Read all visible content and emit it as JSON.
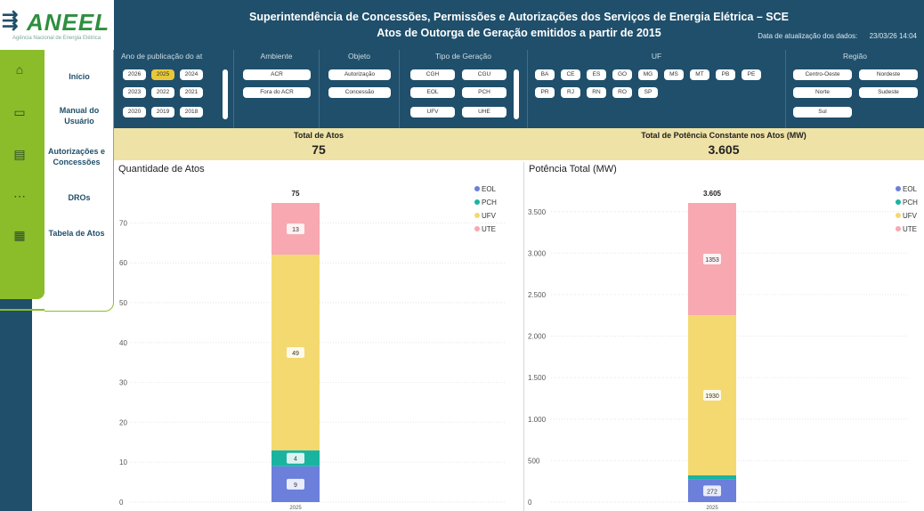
{
  "logo": {
    "text": "ANEEL",
    "subtitle": "Agência Nacional de Energia Elétrica"
  },
  "nav": {
    "items": [
      {
        "label": "Início"
      },
      {
        "label": "Manual do Usuário"
      },
      {
        "label": "Autorizações e Concessões"
      },
      {
        "label": "DROs"
      },
      {
        "label": "Tabela de Atos"
      }
    ]
  },
  "header": {
    "title": "Superintendência de Concessões, Permissões e Autorizações dos Serviços de Energia Elétrica – SCE",
    "subtitle": "Atos de Outorga de Geração emitidos a partir de 2015",
    "date_label": "Data de atualização dos dados:",
    "date_value": "23/03/26 14:04"
  },
  "filters": {
    "ano": {
      "label": "Ano de publicação do at",
      "options": [
        "2026",
        "2025",
        "2024",
        "2023",
        "2022",
        "2021",
        "2020",
        "2019",
        "2018"
      ],
      "selected": "2025"
    },
    "ambiente": {
      "label": "Ambiente",
      "options": [
        "ACR",
        "Fora do ACR"
      ]
    },
    "objeto": {
      "label": "Objeto",
      "options": [
        "Autorização",
        "Concessão"
      ]
    },
    "tipo": {
      "label": "Tipo de Geração",
      "options": [
        "CGH",
        "CGU",
        "EOL",
        "PCH",
        "UFV",
        "UHE"
      ]
    },
    "uf": {
      "label": "UF",
      "options": [
        "BA",
        "CE",
        "ES",
        "GO",
        "MG",
        "MS",
        "MT",
        "PB",
        "PE",
        "PR",
        "RJ",
        "RN",
        "RO",
        "SP"
      ]
    },
    "regiao": {
      "label": "Região",
      "options": [
        "Centro-Oeste",
        "Nordeste",
        "Norte",
        "Sudeste",
        "Sul"
      ]
    }
  },
  "kpis": {
    "total_atos_label": "Total de Atos",
    "total_atos_value": "75",
    "total_potencia_label": "Total de Potência Constante nos Atos (MW)",
    "total_potencia_value": "3.605"
  },
  "colors": {
    "EOL": "#6b7fdb",
    "PCH": "#19b4a0",
    "UFV": "#f4d971",
    "UTE": "#f7a8b0",
    "header": "#1f4f6b",
    "accent": "#8bbd2a",
    "selected": "#e8c83a",
    "kpi_bg": "#efe2a6"
  },
  "chart_data": [
    {
      "type": "bar",
      "stacked": true,
      "title": "Quantidade de Atos",
      "categories": [
        "2025"
      ],
      "series": [
        {
          "name": "EOL",
          "values": [
            9
          ]
        },
        {
          "name": "PCH",
          "values": [
            4
          ]
        },
        {
          "name": "UFV",
          "values": [
            49
          ]
        },
        {
          "name": "UTE",
          "values": [
            13
          ]
        }
      ],
      "total_labels": [
        "75"
      ],
      "ylim": [
        0,
        75
      ],
      "yticks": [
        0,
        10,
        20,
        30,
        40,
        50,
        60,
        70
      ],
      "ytick_labels": [
        "0",
        "10",
        "20",
        "30",
        "40",
        "50",
        "60",
        "70"
      ],
      "legend": "top-right",
      "grid": true
    },
    {
      "type": "bar",
      "stacked": true,
      "title": "Potência Total (MW)",
      "categories": [
        "2025"
      ],
      "series": [
        {
          "name": "EOL",
          "values": [
            272
          ]
        },
        {
          "name": "PCH",
          "values": [
            50
          ]
        },
        {
          "name": "UFV",
          "values": [
            1930
          ]
        },
        {
          "name": "UTE",
          "values": [
            1353
          ]
        }
      ],
      "data_labels": {
        "EOL": "272",
        "UFV": "1930",
        "UTE": "1353"
      },
      "total_labels": [
        "3.605"
      ],
      "ylim": [
        0,
        3605
      ],
      "yticks": [
        0,
        500,
        1000,
        1500,
        2000,
        2500,
        3000,
        3500
      ],
      "ytick_labels": [
        "0",
        "500",
        "1.000",
        "1.500",
        "2.000",
        "2.500",
        "3.000",
        "3.500"
      ],
      "legend": "top-right",
      "grid": true
    }
  ]
}
